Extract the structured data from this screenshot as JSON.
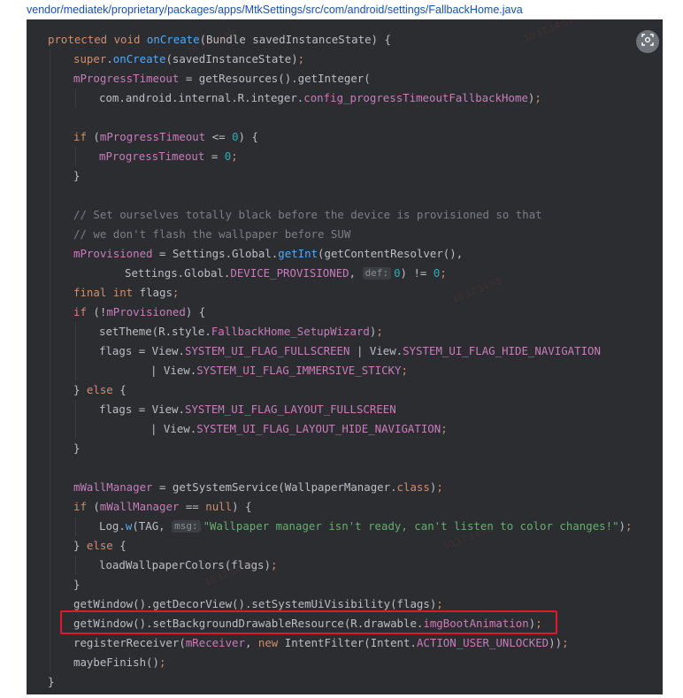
{
  "file_path": "vendor/mediatek/proprietary/packages/apps/MtkSettings/src/com/android/settings/FallbackHome.java",
  "code_lines": [
    {
      "i": 0,
      "parts": [
        [
          "kw",
          "protected void "
        ],
        [
          "mth",
          "onCreate"
        ],
        [
          "",
          "(Bundle savedInstanceState) {"
        ]
      ]
    },
    {
      "i": 1,
      "parts": [
        [
          "kw",
          "super"
        ],
        [
          "",
          "."
        ],
        [
          "mth",
          "onCreate"
        ],
        [
          "",
          "(savedInstanceState)"
        ],
        [
          "kw",
          ";"
        ]
      ]
    },
    {
      "i": 1,
      "parts": [
        [
          "fld",
          "mProgressTimeout"
        ],
        [
          "",
          " = getResources().getInteger("
        ]
      ]
    },
    {
      "i": 2,
      "parts": [
        [
          "",
          "com.android.internal.R.integer."
        ],
        [
          "fld",
          "config_progressTimeoutFallbackHome"
        ],
        [
          "",
          ")"
        ],
        [
          "kw",
          ";"
        ]
      ]
    },
    {
      "i": 1,
      "parts": []
    },
    {
      "i": 1,
      "parts": [
        [
          "kw",
          "if "
        ],
        [
          "",
          "("
        ],
        [
          "fld",
          "mProgressTimeout"
        ],
        [
          "",
          " <= "
        ],
        [
          "num",
          "0"
        ],
        [
          "",
          ") {"
        ]
      ]
    },
    {
      "i": 2,
      "parts": [
        [
          "fld",
          "mProgressTimeout"
        ],
        [
          "",
          " = "
        ],
        [
          "num",
          "0"
        ],
        [
          "kw",
          ";"
        ]
      ]
    },
    {
      "i": 1,
      "parts": [
        [
          "",
          "}"
        ]
      ]
    },
    {
      "i": 1,
      "parts": []
    },
    {
      "i": 1,
      "parts": [
        [
          "cmt",
          "// Set ourselves totally black before the device is provisioned so that"
        ]
      ]
    },
    {
      "i": 1,
      "parts": [
        [
          "cmt",
          "// we don't flash the wallpaper before SUW"
        ]
      ]
    },
    {
      "i": 1,
      "parts": [
        [
          "fld",
          "mProvisioned"
        ],
        [
          "",
          " = Settings.Global."
        ],
        [
          "mth",
          "getInt"
        ],
        [
          "",
          "(getContentResolver(),"
        ]
      ]
    },
    {
      "i": 3,
      "parts": [
        [
          "",
          "Settings.Global."
        ],
        [
          "fld",
          "DEVICE_PROVISIONED"
        ],
        [
          "",
          ", "
        ],
        [
          "hint",
          "def:"
        ],
        [
          "num",
          "0"
        ],
        [
          "",
          ") != "
        ],
        [
          "num",
          "0"
        ],
        [
          "kw",
          ";"
        ]
      ]
    },
    {
      "i": 1,
      "parts": [
        [
          "kw",
          "final int "
        ],
        [
          "",
          "flags"
        ],
        [
          "kw",
          ";"
        ]
      ]
    },
    {
      "i": 1,
      "parts": [
        [
          "kw",
          "if "
        ],
        [
          "",
          "(!"
        ],
        [
          "fld",
          "mProvisioned"
        ],
        [
          "",
          ") {"
        ]
      ]
    },
    {
      "i": 2,
      "parts": [
        [
          "",
          "setTheme(R.style."
        ],
        [
          "fld",
          "FallbackHome_SetupWizard"
        ],
        [
          "",
          ")"
        ],
        [
          "kw",
          ";"
        ]
      ]
    },
    {
      "i": 2,
      "parts": [
        [
          "",
          "flags = View."
        ],
        [
          "fld",
          "SYSTEM_UI_FLAG_FULLSCREEN"
        ],
        [
          "",
          " | View."
        ],
        [
          "fld",
          "SYSTEM_UI_FLAG_HIDE_NAVIGATION"
        ]
      ]
    },
    {
      "i": 4,
      "parts": [
        [
          "",
          "| View."
        ],
        [
          "fld",
          "SYSTEM_UI_FLAG_IMMERSIVE_STICKY"
        ],
        [
          "kw",
          ";"
        ]
      ]
    },
    {
      "i": 1,
      "parts": [
        [
          "",
          "} "
        ],
        [
          "kw",
          "else "
        ],
        [
          "",
          "{"
        ]
      ]
    },
    {
      "i": 2,
      "parts": [
        [
          "",
          "flags = View."
        ],
        [
          "fld",
          "SYSTEM_UI_FLAG_LAYOUT_FULLSCREEN"
        ]
      ]
    },
    {
      "i": 4,
      "parts": [
        [
          "",
          "| View."
        ],
        [
          "fld",
          "SYSTEM_UI_FLAG_LAYOUT_HIDE_NAVIGATION"
        ],
        [
          "kw",
          ";"
        ]
      ]
    },
    {
      "i": 1,
      "parts": [
        [
          "",
          "}"
        ]
      ]
    },
    {
      "i": 1,
      "parts": []
    },
    {
      "i": 1,
      "parts": [
        [
          "fld",
          "mWallManager"
        ],
        [
          "",
          " = getSystemService(WallpaperManager."
        ],
        [
          "kw",
          "class"
        ],
        [
          "",
          ")"
        ],
        [
          "kw",
          ";"
        ]
      ]
    },
    {
      "i": 1,
      "parts": [
        [
          "kw",
          "if "
        ],
        [
          "",
          "("
        ],
        [
          "fld",
          "mWallManager"
        ],
        [
          "",
          " == "
        ],
        [
          "kw",
          "null"
        ],
        [
          "",
          ") {"
        ]
      ]
    },
    {
      "i": 2,
      "parts": [
        [
          "",
          "Log."
        ],
        [
          "mth",
          "w"
        ],
        [
          "",
          "(TAG, "
        ],
        [
          "hint",
          "msg:"
        ],
        [
          "str",
          "\"Wallpaper manager isn't ready, can't listen to color changes!\""
        ],
        [
          "",
          ")"
        ],
        [
          "kw",
          ";"
        ]
      ]
    },
    {
      "i": 1,
      "parts": [
        [
          "",
          "} "
        ],
        [
          "kw",
          "else "
        ],
        [
          "",
          "{"
        ]
      ]
    },
    {
      "i": 2,
      "parts": [
        [
          "",
          "loadWallpaperColors(flags)"
        ],
        [
          "kw",
          ";"
        ]
      ]
    },
    {
      "i": 1,
      "parts": [
        [
          "",
          "}"
        ]
      ]
    },
    {
      "i": 1,
      "parts": [
        [
          "",
          "getWindow().getDecorView().setSystemUiVisibility(flags)"
        ],
        [
          "kw",
          ";"
        ]
      ]
    },
    {
      "i": 1,
      "parts": [
        [
          "",
          "getWindow().setBackgroundDrawableResource(R.drawable."
        ],
        [
          "fld",
          "imgBootAnimation"
        ],
        [
          "",
          ")"
        ],
        [
          "kw",
          ";"
        ]
      ]
    },
    {
      "i": 1,
      "parts": [
        [
          "",
          "registerReceiver("
        ],
        [
          "fld",
          "mReceiver"
        ],
        [
          "",
          ", "
        ],
        [
          "kw",
          "new "
        ],
        [
          "",
          "IntentFilter(Intent."
        ],
        [
          "fld",
          "ACTION_USER_UNLOCKED"
        ],
        [
          "",
          "))"
        ],
        [
          "kw",
          ";"
        ]
      ]
    },
    {
      "i": 1,
      "parts": [
        [
          "",
          "maybeFinish()"
        ],
        [
          "kw",
          ";"
        ]
      ]
    },
    {
      "i": 0,
      "parts": [
        [
          "",
          "}"
        ]
      ]
    }
  ],
  "highlighted_line": "getWindow().setBackgroundDrawableResource(R.drawable.imgBootAnimation);",
  "scan_button_icon": "scan-icon",
  "watermarks": [
    "10.17:14:59",
    "10.17:14:59 .zhao",
    "10.17:14:59",
    "10.17:14:59",
    "10.17:14:59"
  ],
  "colors": {
    "editor_bg": "#2b2d30",
    "keyword": "#cf8e6d",
    "number": "#2aacb8",
    "string": "#6aab73",
    "comment": "#7a7e85",
    "field": "#c77dbb",
    "method": "#56a8f5",
    "highlight_border": "#e0182d",
    "path_text": "#1a4fb5"
  }
}
